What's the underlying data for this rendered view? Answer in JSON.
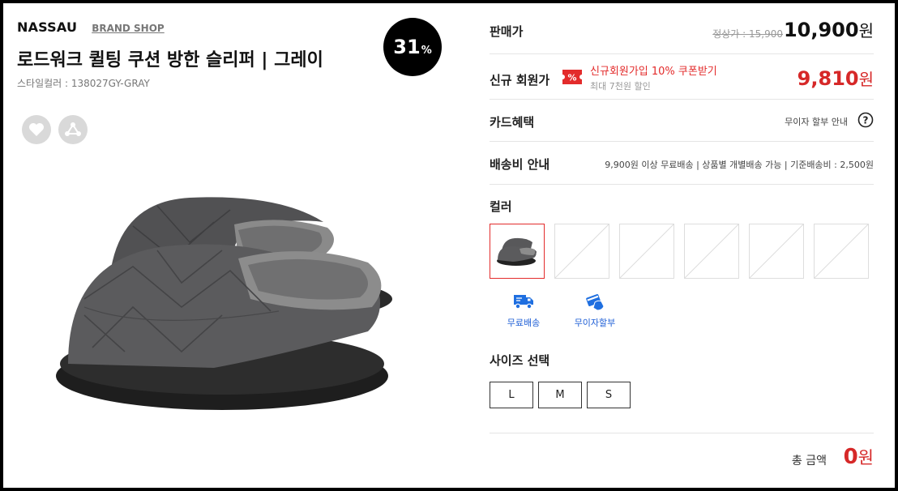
{
  "brand": {
    "name": "NASSAU",
    "shop_link": "BRAND SHOP"
  },
  "product": {
    "title": "로드워크 퀼팅 쿠션 방한 슬리퍼 | 그레이",
    "style_color": "스타일컬러 : 138027GY-GRAY",
    "discount_number": "31",
    "discount_symbol": "%"
  },
  "price": {
    "label": "판매가",
    "original": "정상가 : 15,900",
    "sale_number": "10,900",
    "unit": "원"
  },
  "member": {
    "label": "신규 회원가",
    "coupon_icon": "coupon-percent-icon",
    "coupon_text": "신규회원가입 10% 쿠폰받기",
    "coupon_sub": "최대 7천원 할인",
    "price_number": "9,810",
    "unit": "원"
  },
  "card": {
    "label": "카드혜택",
    "info": "무이자 할부 안내",
    "icon": "question-mark-icon"
  },
  "shipping": {
    "label": "배송비 안내",
    "info": "9,900원 이상 무료배송 | 상품별 개별배송 가능 | 기준배송비 : 2,500원"
  },
  "color": {
    "label": "컬러",
    "swatches": [
      {
        "type": "product-thumbnail",
        "selected": true
      },
      {
        "type": "empty",
        "selected": false
      },
      {
        "type": "empty",
        "selected": false
      },
      {
        "type": "empty",
        "selected": false
      },
      {
        "type": "empty",
        "selected": false
      },
      {
        "type": "empty",
        "selected": false
      }
    ]
  },
  "benefits": [
    {
      "icon": "delivery-truck-icon",
      "label": "무료배송"
    },
    {
      "icon": "card-installment-icon",
      "label": "무이자할부"
    }
  ],
  "size": {
    "label": "사이즈 선택",
    "options": [
      "L",
      "M",
      "S"
    ]
  },
  "total": {
    "label": "총 금액",
    "number": "0",
    "unit": "원"
  },
  "colors": {
    "accent_red": "#d62828",
    "link_blue": "#1f5fd6",
    "badge_black": "#000000"
  }
}
